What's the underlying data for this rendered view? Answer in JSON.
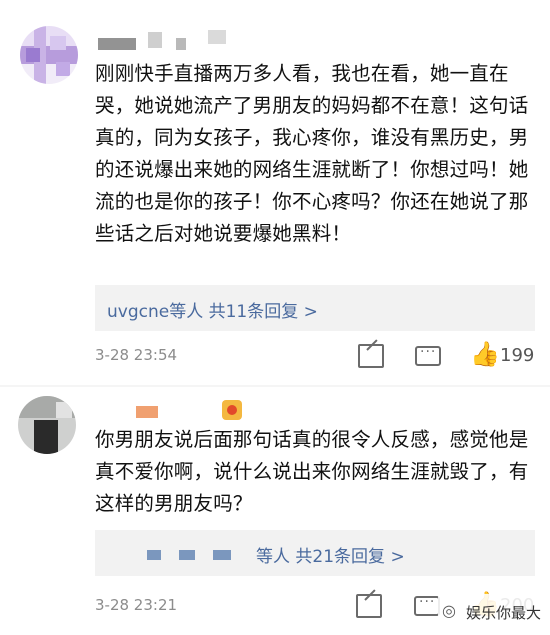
{
  "comments": [
    {
      "text": "刚刚快手直播两万多人看，我也在看，她一直在哭，她说她流产了男朋友的妈妈都不在意！这句话真的，同为女孩子，我心疼你，谁没有黑历史，男的还说爆出来她的网络生涯就断了！你想过吗！她流的也是你的孩子！你不心疼吗？你还在她说了那些话之后对她说要爆她黑料！",
      "reply_summary": "uvgcne等人 共11条回复 >",
      "time": "3-28 23:54",
      "like_count": "199",
      "icons": [
        "share-icon",
        "comment-icon",
        "like-icon"
      ]
    },
    {
      "text": "你男朋友说后面那句话真的很令人反感，感觉他是真不爱你啊，说什么说出来你网络生涯就毁了，有这样的男朋友吗？",
      "reply_summary": "等人 共21条回复 >",
      "time": "3-28 23:21",
      "like_count": "200",
      "icons": [
        "share-icon",
        "comment-icon",
        "like-icon"
      ]
    }
  ],
  "watermark": {
    "text": "娱乐你最大",
    "icon": "wechat-icon"
  },
  "colors": {
    "link": "#4a6a9e",
    "reply_bg": "#f2f2f2",
    "meta": "#8c8c8c"
  }
}
